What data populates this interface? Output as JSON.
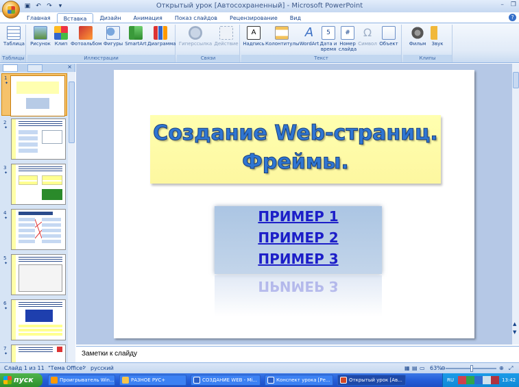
{
  "window": {
    "title": "Открытый урок [Автосохраненный] - Microsoft PowerPoint"
  },
  "ribbon": {
    "tabs": [
      "Главная",
      "Вставка",
      "Дизайн",
      "Анимация",
      "Показ слайдов",
      "Рецензирование",
      "Вид"
    ],
    "active_tab": "Вставка",
    "groups": {
      "tables": {
        "label": "Таблицы",
        "buttons": [
          "Таблица"
        ]
      },
      "illustrations": {
        "label": "Иллюстрации",
        "buttons": [
          "Рисунок",
          "Клип",
          "Фотоальбом",
          "Фигуры",
          "SmartArt",
          "Диаграмма"
        ]
      },
      "links": {
        "label": "Связи",
        "buttons": [
          "Гиперссылка",
          "Действие"
        ]
      },
      "text": {
        "label": "Текст",
        "buttons": [
          "Надпись",
          "Колонтитулы",
          "WordArt",
          "Дата и время",
          "Номер слайда",
          "Символ",
          "Объект"
        ]
      },
      "media": {
        "label": "Клипы мультимедиа",
        "buttons": [
          "Фильм",
          "Звук"
        ]
      }
    }
  },
  "thumbnails": [
    {
      "num": "1"
    },
    {
      "num": "2"
    },
    {
      "num": "3"
    },
    {
      "num": "4"
    },
    {
      "num": "5"
    },
    {
      "num": "6"
    },
    {
      "num": "7"
    }
  ],
  "slide": {
    "title_line1": "Создание Web-страниц.",
    "title_line2": "Фреймы.",
    "links": [
      "ПРИМЕР 1",
      "ПРИМЕР 2",
      "ПРИМЕР 3"
    ],
    "reflection_text": "ПРИМЕР 3"
  },
  "notes": {
    "placeholder": "Заметки к слайду"
  },
  "statusbar": {
    "slide_info": "Слайд 1 из 11",
    "theme": "\"Тема Office\"",
    "language": "русский",
    "zoom": "63%"
  },
  "taskbar": {
    "start": "пуск",
    "buttons": [
      "Проигрыватель Win...",
      "РАЗНОЕ РУС+",
      "СОЗДАНИЕ WEB - Mi...",
      "Конспект урока [Ре...",
      "Открытый урок [Ав..."
    ],
    "lang": "RU",
    "clock": "13:42"
  },
  "colors": {
    "title_fill": "#2f76d2",
    "title_box": "#ffffb0",
    "link": "#1c1ec8",
    "selected_thumb": "#f6c26b"
  }
}
